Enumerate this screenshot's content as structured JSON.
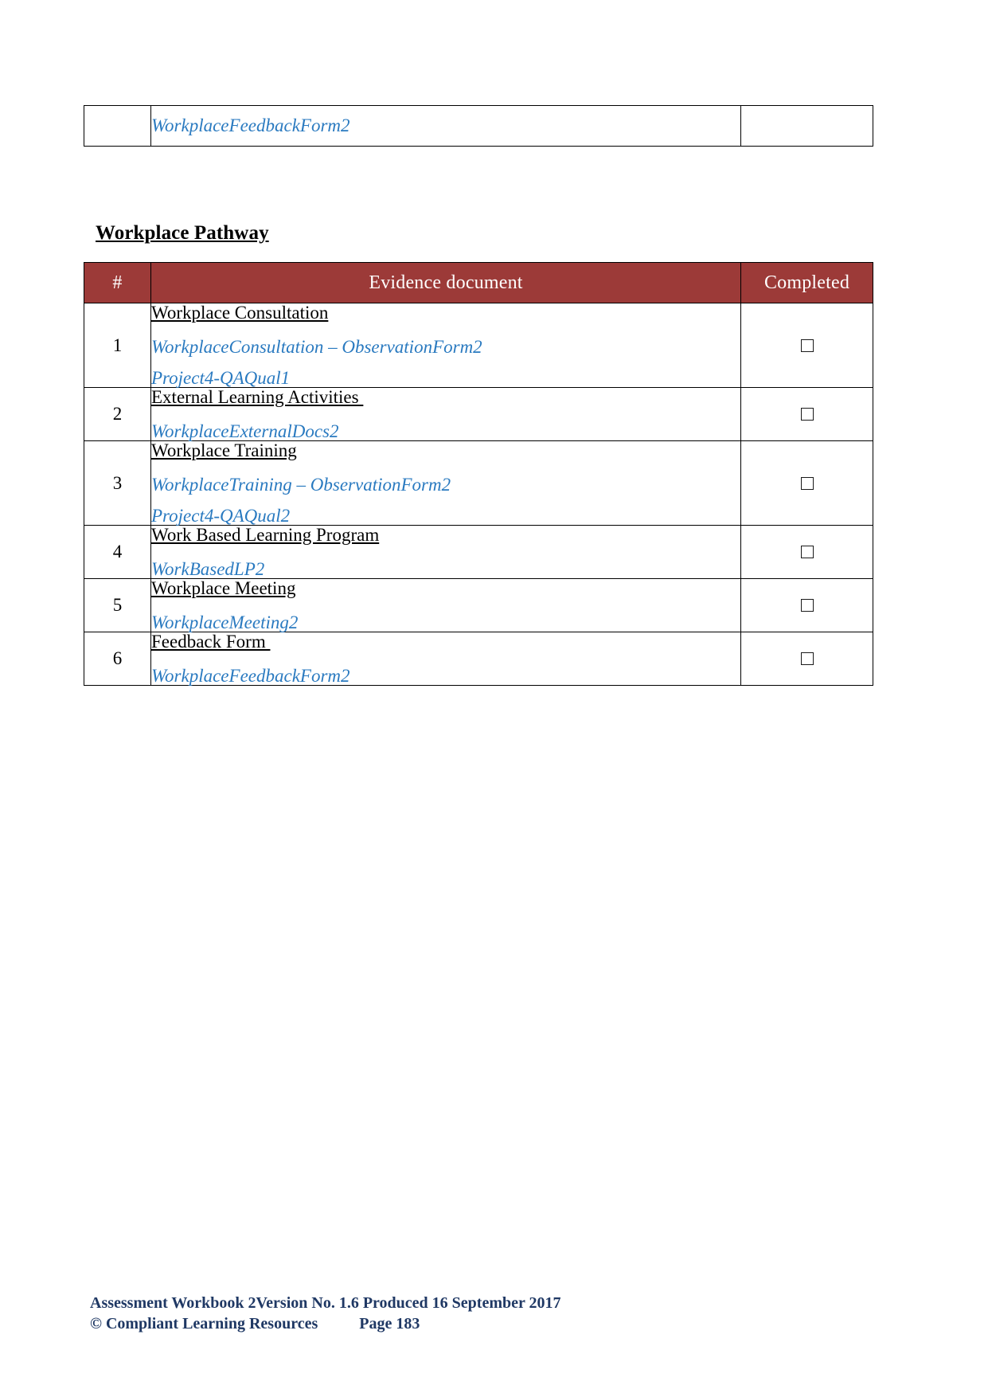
{
  "colors": {
    "table_header_bg": "#9C3A38",
    "table_header_text": "#FFFFFF",
    "link_text": "#2A7AC0",
    "footer_text": "#1F3864",
    "border": "#000000"
  },
  "top_table": {
    "number": "",
    "document_file": "WorkplaceFeedbackForm2",
    "completed": ""
  },
  "section": {
    "heading": "Workplace Pathway"
  },
  "table": {
    "headers": {
      "number": "#",
      "document": "Evidence document",
      "completed": "Completed"
    },
    "rows": [
      {
        "number": "1",
        "title": "Workplace Consultation",
        "files": [
          "WorkplaceConsultation – ObservationForm2",
          "Project4-QAQual1"
        ],
        "completed": false
      },
      {
        "number": "2",
        "title": "External Learning Activities ",
        "files": [
          "WorkplaceExternalDocs2"
        ],
        "completed": false
      },
      {
        "number": "3",
        "title": "Workplace Training",
        "files": [
          "WorkplaceTraining – ObservationForm2",
          "Project4-QAQual2"
        ],
        "completed": false
      },
      {
        "number": "4",
        "title": "Work Based Learning Program",
        "files": [
          "WorkBasedLP2"
        ],
        "completed": false
      },
      {
        "number": "5",
        "title": "Workplace Meeting",
        "files": [
          "WorkplaceMeeting2"
        ],
        "completed": false
      },
      {
        "number": "6",
        "title": "Feedback Form ",
        "files": [
          "WorkplaceFeedbackForm2"
        ],
        "completed": false
      }
    ]
  },
  "footer": {
    "line1": "Assessment Workbook 2Version No. 1.6 Produced 16 September 2017",
    "line2_left": "© Compliant Learning Resources",
    "line2_right": "Page 183"
  }
}
